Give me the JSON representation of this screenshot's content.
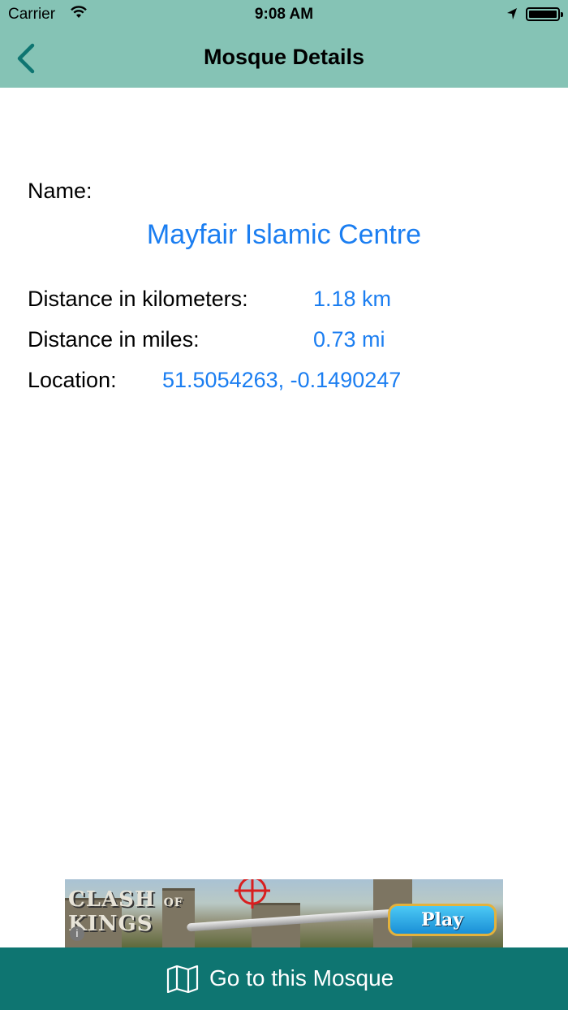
{
  "status_bar": {
    "carrier": "Carrier",
    "time": "9:08 AM",
    "icons": [
      "wifi-icon",
      "location-arrow-icon",
      "battery-icon"
    ]
  },
  "nav": {
    "title": "Mosque Details",
    "back_icon": "chevron-left-icon"
  },
  "details": {
    "name_label": "Name:",
    "name_value": "Mayfair Islamic Centre",
    "km_label": "Distance in kilometers:",
    "km_value": "1.18 km",
    "miles_label": "Distance in miles:",
    "miles_value": "0.73 mi",
    "location_label": "Location:",
    "location_value": "51.5054263, -0.1490247"
  },
  "ad": {
    "logo_line1": "CLASH",
    "logo_of": "OF",
    "logo_line2": "KINGS",
    "play_label": "Play",
    "info_label": "i"
  },
  "bottom_bar": {
    "label": "Go to this Mosque",
    "icon": "map-icon"
  },
  "colors": {
    "header_bg": "#85c3b5",
    "accent_text": "#1b7ef1",
    "bottom_bar_bg": "#0e7571"
  }
}
